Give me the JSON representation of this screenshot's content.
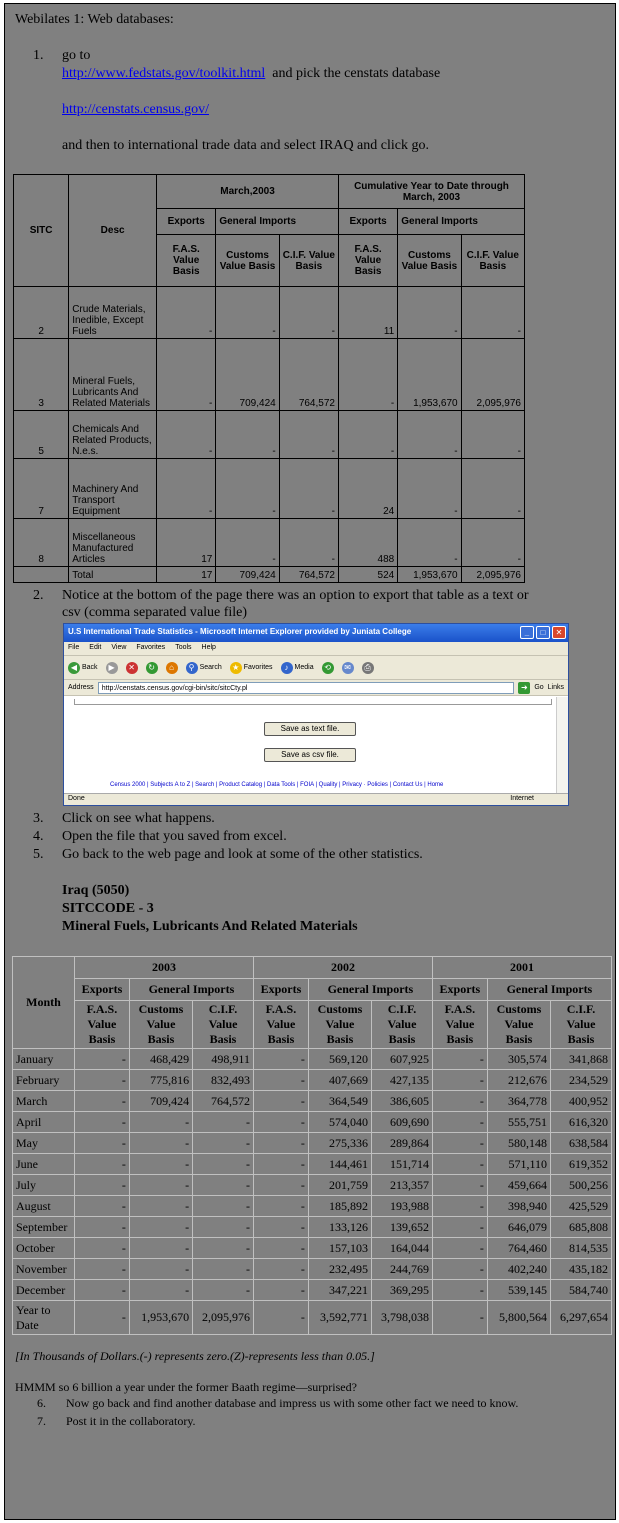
{
  "intro": "Webilates 1: Web databases:",
  "step1": {
    "num": "1.",
    "text1": "go to",
    "link1": "http://www.fedstats.gov/toolkit.html",
    "text2": "and pick the censtats database",
    "link2": "http://censtats.census.gov/",
    "text3": "and then to international trade data and select IRAQ and click go."
  },
  "table1": {
    "h_sitc": "SITC",
    "h_desc": "Desc",
    "h_march": "March,2003",
    "h_cumul": "Cumulative Year to Date through March, 2003",
    "h_exports": "Exports",
    "h_genimp": "General Imports",
    "h_fas": "F.A.S. Value Basis",
    "h_customs": "Customs Value Basis",
    "h_cif": "C.I.F. Value Basis",
    "rows": [
      {
        "sitc": "2",
        "desc": "Crude Materials, Inedible, Except Fuels",
        "v": [
          "-",
          "-",
          "-",
          "11",
          "-",
          "-"
        ]
      },
      {
        "sitc": "3",
        "desc": "Mineral Fuels, Lubricants And Related Materials",
        "v": [
          "-",
          "709,424",
          "764,572",
          "-",
          "1,953,670",
          "2,095,976"
        ]
      },
      {
        "sitc": "5",
        "desc": "Chemicals And Related Products, N.e.s.",
        "v": [
          "-",
          "-",
          "-",
          "-",
          "-",
          "-"
        ]
      },
      {
        "sitc": "7",
        "desc": "Machinery And Transport Equipment",
        "v": [
          "-",
          "-",
          "-",
          "24",
          "-",
          "-"
        ]
      },
      {
        "sitc": "8",
        "desc": "Miscellaneous Manufactured Articles",
        "v": [
          "17",
          "-",
          "-",
          "488",
          "-",
          "-"
        ]
      }
    ],
    "total": {
      "label": "Total",
      "v": [
        "17",
        "709,424",
        "764,572",
        "524",
        "1,953,670",
        "2,095,976"
      ]
    }
  },
  "step2": {
    "num": "2.",
    "text": "Notice at the bottom of the page there was an option to export that table as a text or",
    "text_cont": "csv (comma separated value file)"
  },
  "browser": {
    "title": "U.S International Trade Statistics - Microsoft Internet Explorer provided by Juniata College",
    "menu": [
      "File",
      "Edit",
      "View",
      "Favorites",
      "Tools",
      "Help"
    ],
    "back": "Back",
    "search": "Search",
    "favorites": "Favorites",
    "media": "Media",
    "address_label": "Address",
    "address": "http://censtats.census.gov/cgi-bin/sitc/sitcCty.pl",
    "go": "Go",
    "links": "Links",
    "save_text": "Save as text file.",
    "save_csv": "Save as csv file.",
    "footer_links": "Census 2000 | Subjects A to Z | Search | Product Catalog | Data Tools | FOIA | Quality | Privacy · Policies | Contact Us | Home",
    "status_left": "Done",
    "status_right": "Internet"
  },
  "step3": {
    "num": "3.",
    "text": "Click on see what happens."
  },
  "step4": {
    "num": "4.",
    "text": "Open the file that you saved from excel."
  },
  "step5": {
    "num": "5.",
    "text": "Go back to the web page and look at some of the other statistics."
  },
  "iraq": {
    "line1": "Iraq (5050)",
    "line2": "SITCCODE - 3",
    "line3": "Mineral Fuels, Lubricants And Related Materials"
  },
  "table2": {
    "h_month": "Month",
    "years": [
      "2003",
      "2002",
      "2001"
    ],
    "h_exports": "Exports",
    "h_genimp": "General Imports",
    "h_fas": "F.A.S. Value Basis",
    "h_customs": "Customs Value Basis",
    "h_cif": "C.I.F. Value Basis",
    "rows": [
      {
        "m": "January",
        "v": [
          "-",
          "468,429",
          "498,911",
          "-",
          "569,120",
          "607,925",
          "-",
          "305,574",
          "341,868"
        ]
      },
      {
        "m": "February",
        "v": [
          "-",
          "775,816",
          "832,493",
          "-",
          "407,669",
          "427,135",
          "-",
          "212,676",
          "234,529"
        ]
      },
      {
        "m": "March",
        "v": [
          "-",
          "709,424",
          "764,572",
          "-",
          "364,549",
          "386,605",
          "-",
          "364,778",
          "400,952"
        ]
      },
      {
        "m": "April",
        "v": [
          "-",
          "-",
          "-",
          "-",
          "574,040",
          "609,690",
          "-",
          "555,751",
          "616,320"
        ]
      },
      {
        "m": "May",
        "v": [
          "-",
          "-",
          "-",
          "-",
          "275,336",
          "289,864",
          "-",
          "580,148",
          "638,584"
        ]
      },
      {
        "m": "June",
        "v": [
          "-",
          "-",
          "-",
          "-",
          "144,461",
          "151,714",
          "-",
          "571,110",
          "619,352"
        ]
      },
      {
        "m": "July",
        "v": [
          "-",
          "-",
          "-",
          "-",
          "201,759",
          "213,357",
          "-",
          "459,664",
          "500,256"
        ]
      },
      {
        "m": "August",
        "v": [
          "-",
          "-",
          "-",
          "-",
          "185,892",
          "193,988",
          "-",
          "398,940",
          "425,529"
        ]
      },
      {
        "m": "September",
        "v": [
          "-",
          "-",
          "-",
          "-",
          "133,126",
          "139,652",
          "-",
          "646,079",
          "685,808"
        ]
      },
      {
        "m": "October",
        "v": [
          "-",
          "-",
          "-",
          "-",
          "157,103",
          "164,044",
          "-",
          "764,460",
          "814,535"
        ]
      },
      {
        "m": "November",
        "v": [
          "-",
          "-",
          "-",
          "-",
          "232,495",
          "244,769",
          "-",
          "402,240",
          "435,182"
        ]
      },
      {
        "m": "December",
        "v": [
          "-",
          "-",
          "-",
          "-",
          "347,221",
          "369,295",
          "-",
          "539,145",
          "584,740"
        ]
      },
      {
        "m": "Year to Date",
        "v": [
          "-",
          "1,953,670",
          "2,095,976",
          "-",
          "3,592,771",
          "3,798,038",
          "-",
          "5,800,564",
          "6,297,654"
        ]
      }
    ]
  },
  "note": "[In Thousands of Dollars.(-) represents zero.(Z)-represents less than 0.05.]",
  "hmm": "HMMM so 6 billion a year under the former Baath regime—surprised?",
  "step6": {
    "num": "6.",
    "text": "Now go back and find another database and impress us with some other fact we need to know."
  },
  "step7": {
    "num": "7.",
    "text": "Post it in the collaboratory."
  }
}
